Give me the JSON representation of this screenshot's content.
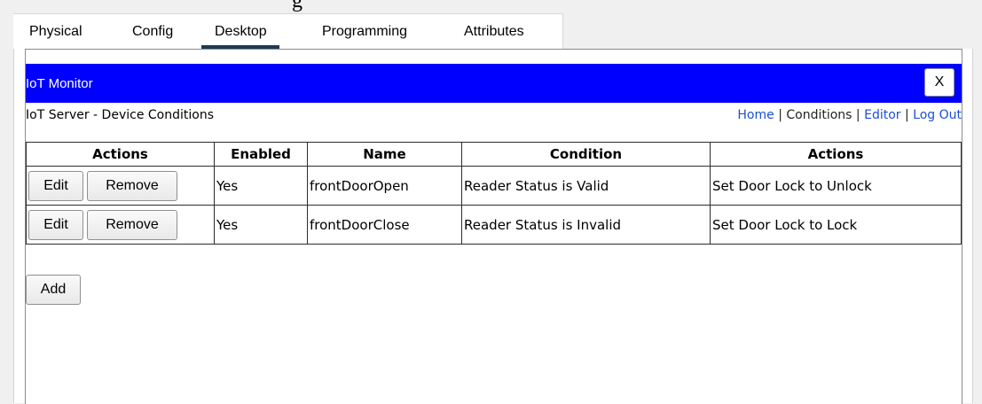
{
  "top_fragment": "g",
  "tabs": [
    {
      "label": "Physical"
    },
    {
      "label": "Config"
    },
    {
      "label": "Desktop",
      "active": true
    },
    {
      "label": "Programming"
    },
    {
      "label": "Attributes"
    }
  ],
  "window": {
    "title": "IoT Monitor",
    "close_label": "X",
    "accent_color": "#0000ff"
  },
  "subheader": {
    "title": "IoT Server - Device Conditions",
    "nav": {
      "home": "Home",
      "separator": "|",
      "conditions": "Conditions",
      "editor": "Editor",
      "logout": "Log Out"
    }
  },
  "table": {
    "headers": [
      "Actions",
      "Enabled",
      "Name",
      "Condition",
      "Actions"
    ],
    "rows": [
      {
        "edit_label": "Edit",
        "remove_label": "Remove",
        "enabled": "Yes",
        "name": "frontDoorOpen",
        "condition": "Reader Status is Valid",
        "action": "Set Door Lock to Unlock"
      },
      {
        "edit_label": "Edit",
        "remove_label": "Remove",
        "enabled": "Yes",
        "name": "frontDoorClose",
        "condition": "Reader Status is Invalid",
        "action": "Set Door Lock to Lock"
      }
    ]
  },
  "add_label": "Add"
}
